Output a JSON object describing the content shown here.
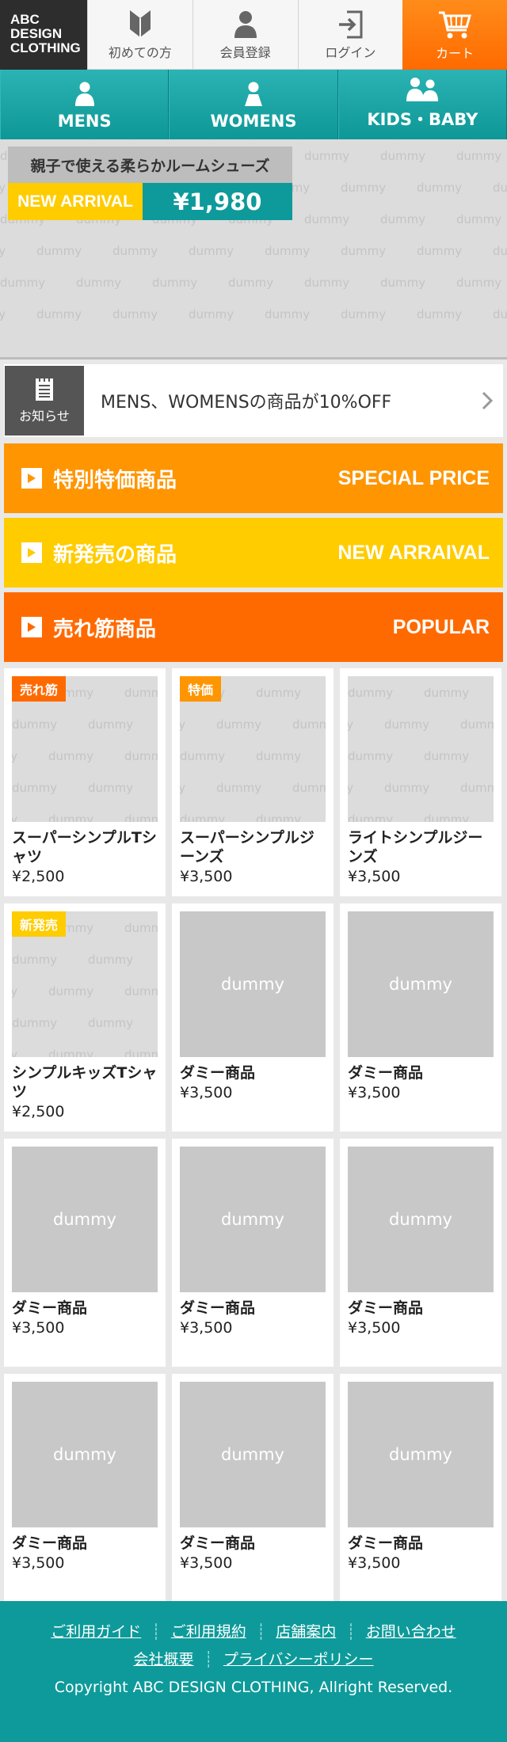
{
  "header": {
    "logo_lines": [
      "ABC",
      "DESIGN",
      "CLOTHING"
    ],
    "nav": [
      {
        "label": "初めての方",
        "icon": "beginner-icon"
      },
      {
        "label": "会員登録",
        "icon": "user-icon"
      },
      {
        "label": "ログイン",
        "icon": "login-icon"
      },
      {
        "label": "カート",
        "icon": "cart-icon"
      }
    ]
  },
  "categories": [
    {
      "label": "MENS",
      "icon": "man-icon"
    },
    {
      "label": "WOMENS",
      "icon": "woman-icon"
    },
    {
      "label": "KIDS・BABY",
      "icon": "family-icon"
    }
  ],
  "hero": {
    "title": "親子で使える柔らかルームシューズ",
    "badge": "NEW ARRIVAL",
    "price": "¥1,980",
    "placeholder_text": "dummy"
  },
  "notice": {
    "icon_label": "お知らせ",
    "text": "MENS、WOMENSの商品が10%OFF"
  },
  "banners": [
    {
      "jp": "特別特価商品",
      "en": "SPECIAL PRICE"
    },
    {
      "jp": "新発売の商品",
      "en": "NEW ARRAIVAL"
    },
    {
      "jp": "売れ筋商品",
      "en": "POPULAR"
    }
  ],
  "products": [
    {
      "name": "スーパーシンプルTシャツ",
      "price": "¥2,500",
      "badge": "売れ筋",
      "thumb": "dummy"
    },
    {
      "name": "スーパーシンプルジーンズ",
      "price": "¥3,500",
      "badge": "特価",
      "thumb": "dummy"
    },
    {
      "name": "ライトシンプルジーンズ",
      "price": "¥3,500",
      "badge": "",
      "thumb": "dummy"
    },
    {
      "name": "シンプルキッズTシャツ",
      "price": "¥2,500",
      "badge": "新発売",
      "thumb": "dummy"
    },
    {
      "name": "ダミー商品",
      "price": "¥3,500",
      "badge": "",
      "thumb": "dummy"
    },
    {
      "name": "ダミー商品",
      "price": "¥3,500",
      "badge": "",
      "thumb": "dummy"
    },
    {
      "name": "ダミー商品",
      "price": "¥3,500",
      "badge": "",
      "thumb": "dummy"
    },
    {
      "name": "ダミー商品",
      "price": "¥3,500",
      "badge": "",
      "thumb": "dummy"
    },
    {
      "name": "ダミー商品",
      "price": "¥3,500",
      "badge": "",
      "thumb": "dummy"
    },
    {
      "name": "ダミー商品",
      "price": "¥3,500",
      "badge": "",
      "thumb": "dummy"
    },
    {
      "name": "ダミー商品",
      "price": "¥3,500",
      "badge": "",
      "thumb": "dummy"
    },
    {
      "name": "ダミー商品",
      "price": "¥3,500",
      "badge": "",
      "thumb": "dummy"
    }
  ],
  "footer": {
    "links_row1": [
      "ご利用ガイド",
      "ご利用規約",
      "店舗案内",
      "お問い合わせ"
    ],
    "links_row2": [
      "会社概要",
      "プライバシーポリシー"
    ],
    "copyright": "Copyright ABC DESIGN CLOTHING, Allright Reserved."
  },
  "colors": {
    "teal": "#0e9a9a",
    "orange": "#ff6a00",
    "amber": "#ff9500",
    "yellow": "#ffcc00"
  }
}
